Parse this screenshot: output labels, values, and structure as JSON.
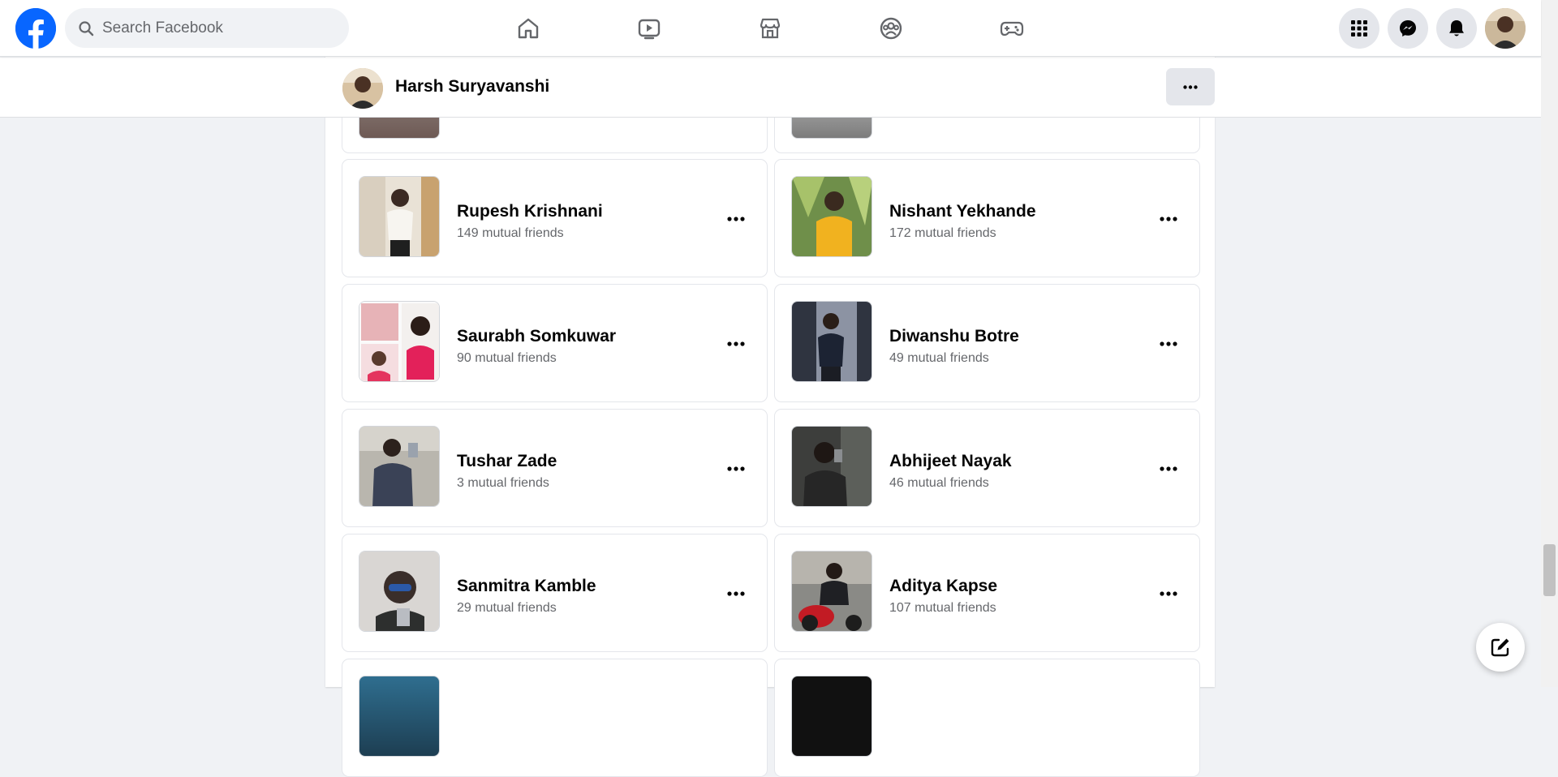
{
  "search": {
    "placeholder": "Search Facebook"
  },
  "nav": {
    "tabs": [
      {
        "icon": "home-icon"
      },
      {
        "icon": "watch-video-icon"
      },
      {
        "icon": "marketplace-icon"
      },
      {
        "icon": "groups-icon"
      },
      {
        "icon": "gaming-icon"
      }
    ],
    "right_buttons": [
      "menu-grid-icon",
      "messenger-icon",
      "notifications-bell-icon"
    ]
  },
  "profile_header": {
    "name": "Harsh Suryavanshi",
    "more_label": "•••"
  },
  "friends": [
    {
      "name": "Rupesh Krishnani",
      "mutual": "149 mutual friends",
      "more": "•••"
    },
    {
      "name": "Nishant Yekhande",
      "mutual": "172 mutual friends",
      "more": "•••"
    },
    {
      "name": "Saurabh Somkuwar",
      "mutual": "90 mutual friends",
      "more": "•••"
    },
    {
      "name": "Diwanshu Botre",
      "mutual": "49 mutual friends",
      "more": "•••"
    },
    {
      "name": "Tushar Zade",
      "mutual": "3 mutual friends",
      "more": "•••"
    },
    {
      "name": "Abhijeet Nayak",
      "mutual": "46 mutual friends",
      "more": "•••"
    },
    {
      "name": "Sanmitra Kamble",
      "mutual": "29 mutual friends",
      "more": "•••"
    },
    {
      "name": "Aditya Kapse",
      "mutual": "107 mutual friends",
      "more": "•••"
    }
  ],
  "colors": {
    "brand": "#0866ff",
    "background": "#f0f2f5",
    "secondary_text": "#65676b",
    "button_bg": "#e4e6eb"
  }
}
